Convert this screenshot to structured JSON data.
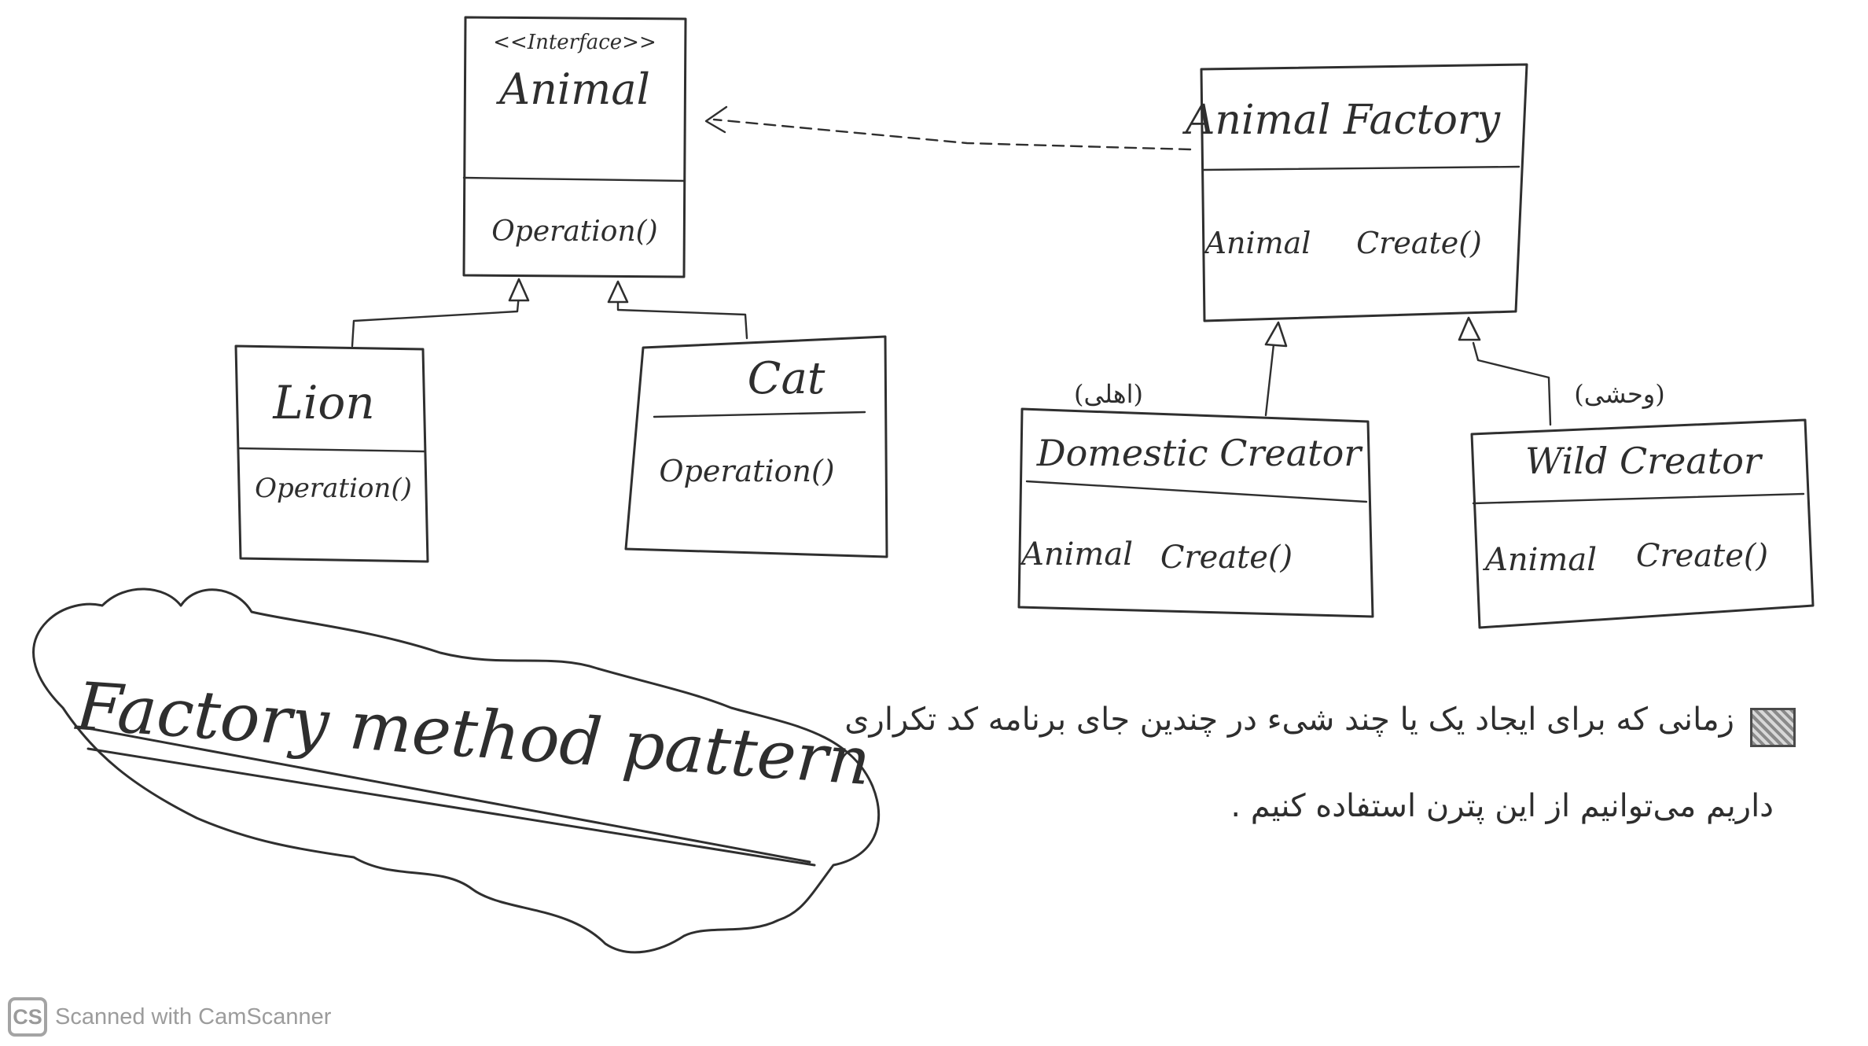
{
  "diagram": {
    "interface": {
      "stereotype": "<<Interface>>",
      "name": "Animal",
      "operation": "Operation()"
    },
    "lion": {
      "name": "Lion",
      "operation": "Operation()"
    },
    "cat": {
      "name": "Cat",
      "operation": "Operation()"
    },
    "factory": {
      "name": "Animal Factory",
      "method_type": "Animal",
      "method_name": "Create()"
    },
    "domestic": {
      "note": "(اهلی)",
      "name": "Domestic Creator",
      "method_type": "Animal",
      "method_name": "Create()"
    },
    "wild": {
      "note": "(وحشی)",
      "name": "Wild Creator",
      "method_type": "Animal",
      "method_name": "Create()"
    },
    "title": "Factory method pattern",
    "description": {
      "line1": "زمانی که برای ایجاد یک یا چند شیء در چندین جای برنامه کد تکراری",
      "line2": "داریم می‌توانیم از این پترن استفاده کنیم ."
    }
  },
  "footer": {
    "logo": "CS",
    "text": "Scanned with CamScanner"
  }
}
